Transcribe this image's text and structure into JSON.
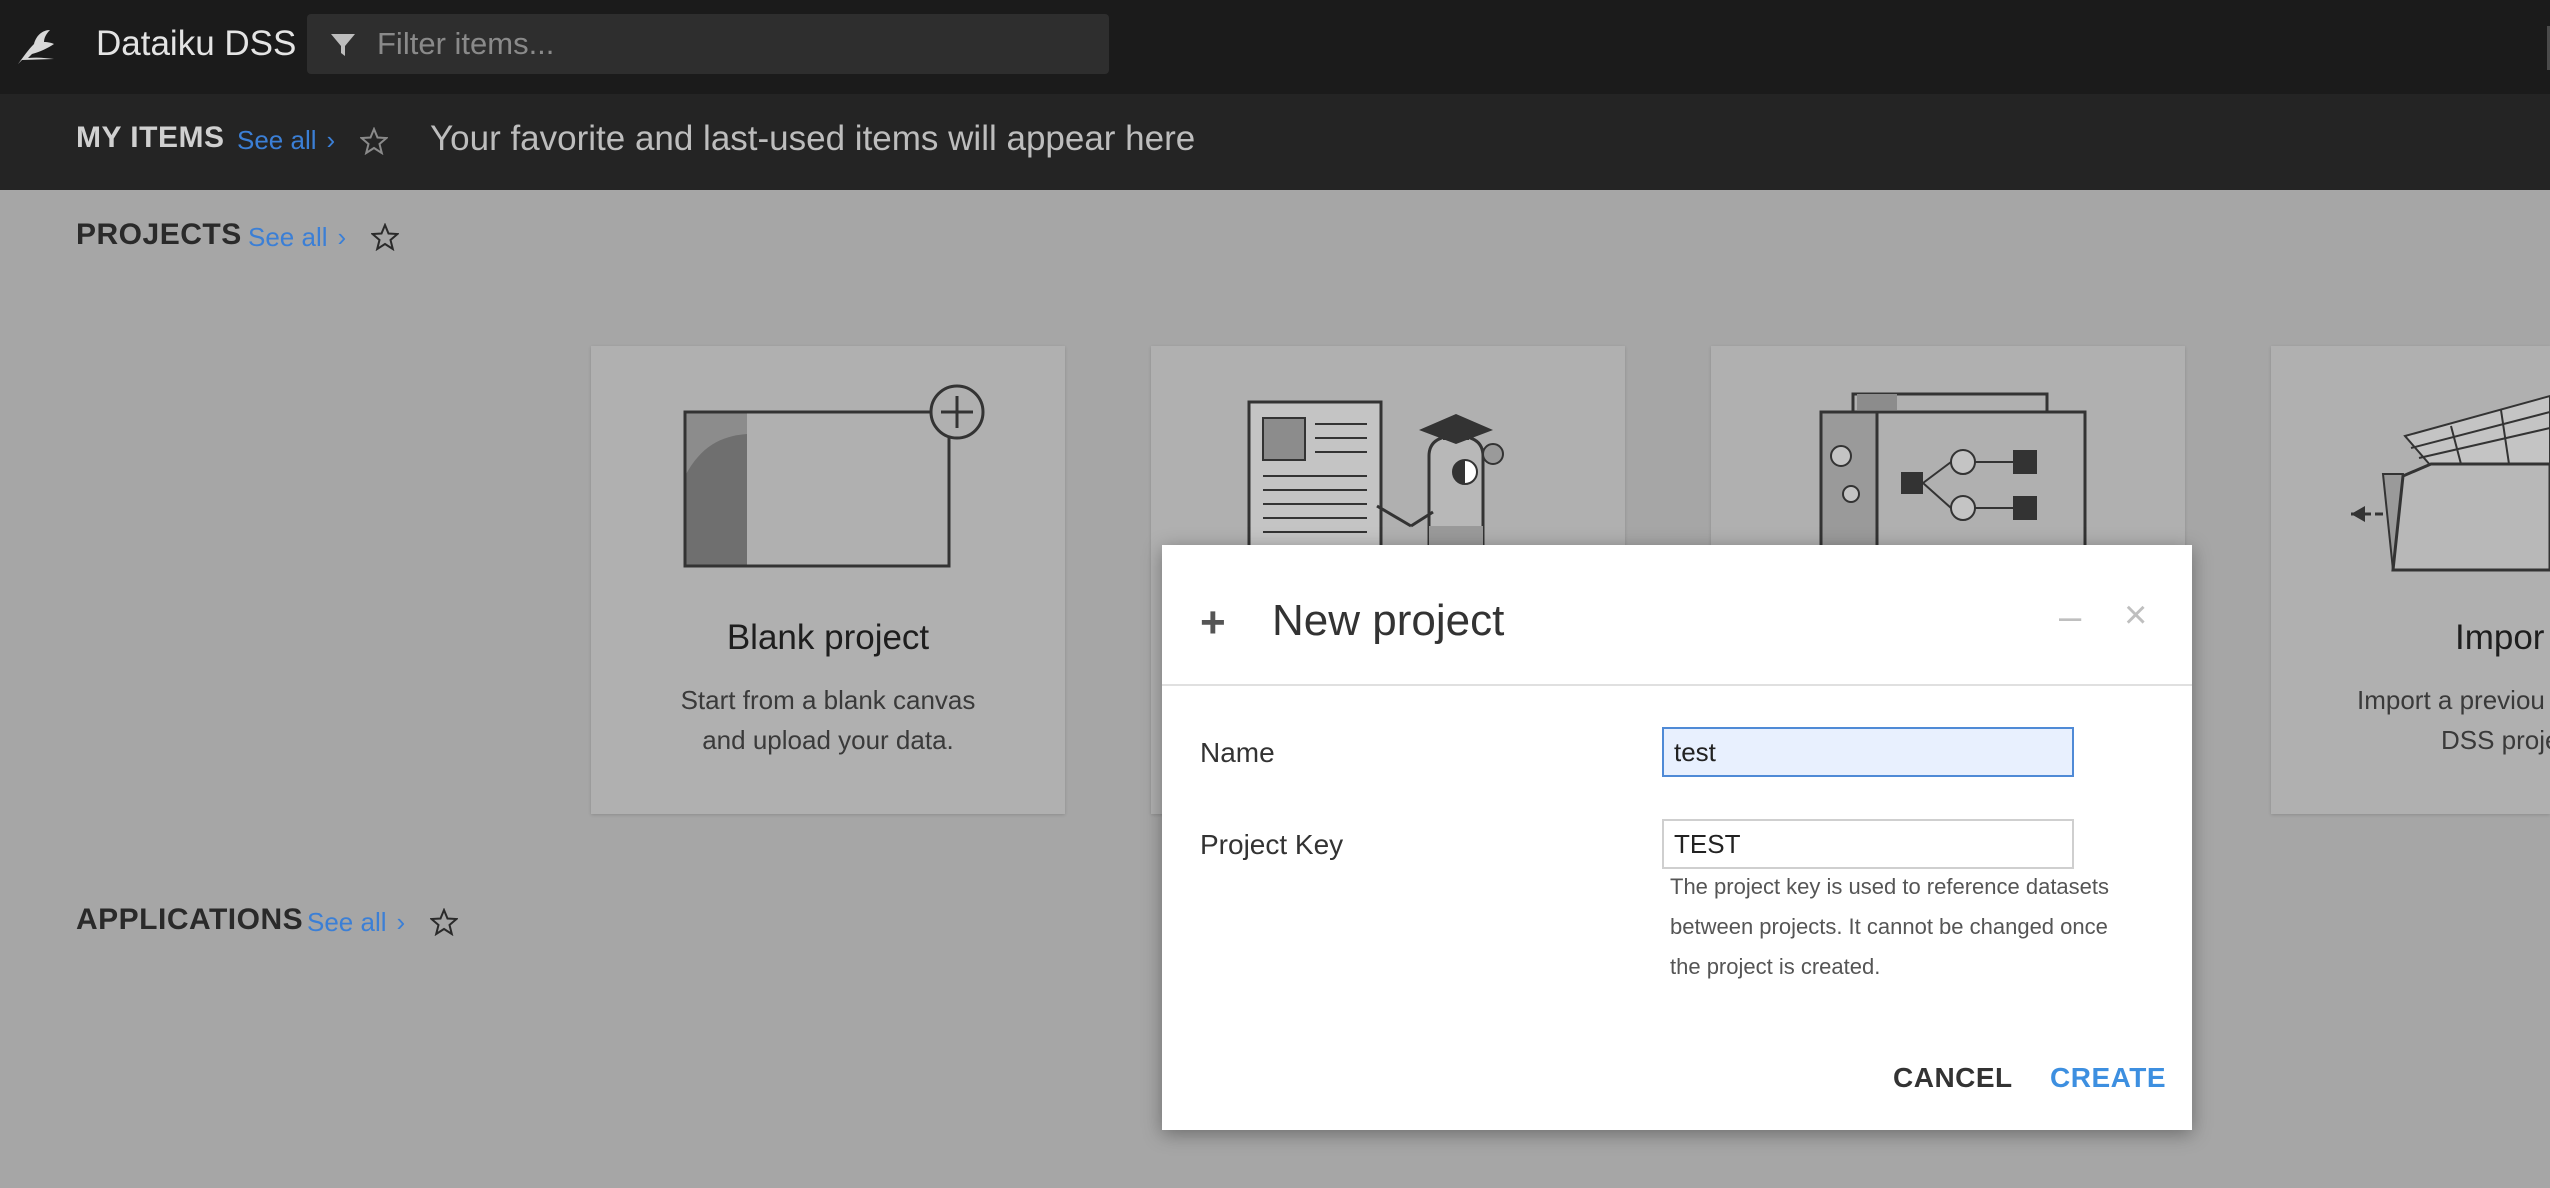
{
  "app": {
    "title": "Dataiku DSS",
    "filter_placeholder": "Filter items..."
  },
  "my_items": {
    "title": "MY ITEMS",
    "see_all": "See all",
    "message": "Your favorite and last-used items will appear here"
  },
  "projects": {
    "title": "PROJECTS",
    "see_all": "See all",
    "cards": [
      {
        "title": "Blank project",
        "desc1": "Start from a blank canvas",
        "desc2": "and upload your data."
      },
      {
        "title": "",
        "desc1": "",
        "desc2": ""
      },
      {
        "title": "",
        "desc1": "",
        "desc2": ""
      },
      {
        "title": "Impor",
        "desc1": "Import a previou",
        "desc2": "DSS proje"
      }
    ]
  },
  "applications": {
    "title": "APPLICATIONS",
    "see_all": "See all"
  },
  "modal": {
    "title": "New project",
    "name_label": "Name",
    "name_value": "test",
    "key_label": "Project Key",
    "key_value": "TEST",
    "help_text": "The project key is used to reference datasets between projects. It cannot be changed once the project is created.",
    "cancel_label": "CANCEL",
    "create_label": "CREATE"
  },
  "colors": {
    "accent": "#3d8fe0",
    "link": "#3b7fd6",
    "topbar": "#1b1b1b"
  }
}
